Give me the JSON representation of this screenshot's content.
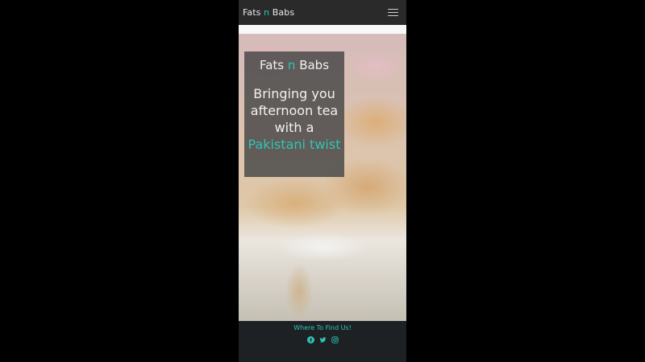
{
  "navbar": {
    "brand_part1": "Fats ",
    "brand_accent": "n",
    "brand_part2": " Babs",
    "menu_icon": "hamburger-menu-icon"
  },
  "hero": {
    "title_part1": "Fats ",
    "title_accent": "n",
    "title_part2": " Babs",
    "tagline_line": "Bringing you afternoon tea with a",
    "tagline_accent": "Pakistani twist",
    "background_image": "samosas-on-cake-stand"
  },
  "footer": {
    "find_us_label": "Where To Find Us!",
    "social_icons": [
      "facebook-icon",
      "twitter-icon",
      "instagram-icon"
    ]
  },
  "colors": {
    "accent": "#2ec4b6",
    "navbar_bg": "#2a2a2a",
    "footer_bg": "#1e2124",
    "card_bg": "#464646"
  }
}
